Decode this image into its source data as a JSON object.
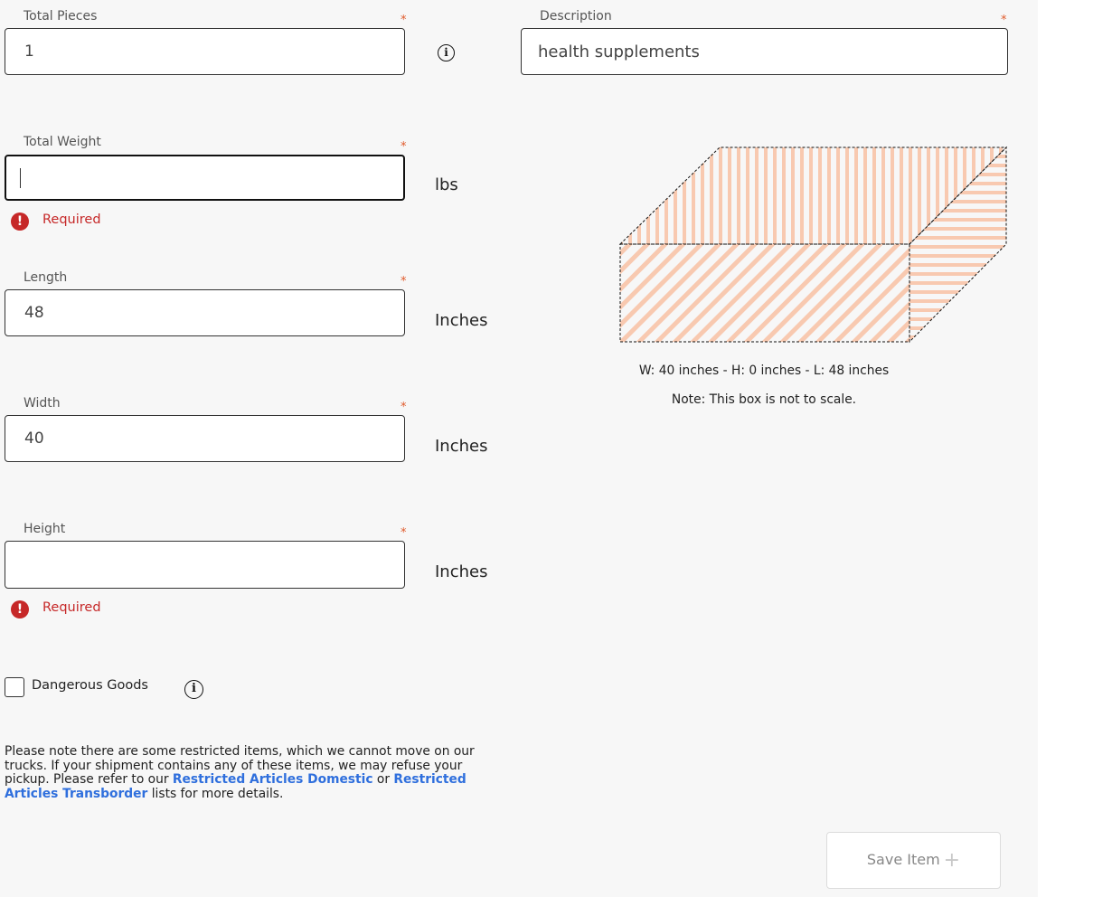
{
  "form": {
    "total_pieces": {
      "label": "Total Pieces",
      "value": "1",
      "required_mark": "*"
    },
    "description": {
      "label": "Description",
      "value": "health supplements",
      "required_mark": "*"
    },
    "total_weight": {
      "label": "Total Weight",
      "value": "",
      "unit": "lbs",
      "required_mark": "*",
      "error": "Required"
    },
    "length": {
      "label": "Length",
      "value": "48",
      "unit": "Inches",
      "required_mark": "*"
    },
    "width": {
      "label": "Width",
      "value": "40",
      "unit": "Inches",
      "required_mark": "*"
    },
    "height": {
      "label": "Height",
      "value": "",
      "unit": "Inches",
      "required_mark": "*",
      "error": "Required"
    },
    "dangerous_goods": {
      "label": "Dangerous Goods",
      "checked": false
    }
  },
  "icons": {
    "info": "info-icon",
    "error": "error-icon",
    "error_glyph": "!",
    "info_glyph": "i"
  },
  "box_preview": {
    "dimensions_caption": "W: 40 inches - H: 0 inches - L: 48 inches",
    "scale_note": "Note: This box is not to scale.",
    "stripe_color": "#f8c9b0"
  },
  "notice": {
    "text_1": "Please note there are some restricted items, which we cannot move on our trucks. If your shipment contains any of these items, we may refuse your pickup. Please refer to our ",
    "link_domestic": "Restricted Articles Domestic",
    "text_2": " or ",
    "link_transborder": "Restricted Articles Transborder",
    "text_3": " lists for more details."
  },
  "actions": {
    "save_label": "Save Item",
    "save_icon": "+"
  },
  "colors": {
    "error": "#c62828",
    "link": "#2f6fdd",
    "required": "#e05a2b",
    "panel_bg": "#f7f7f7"
  }
}
